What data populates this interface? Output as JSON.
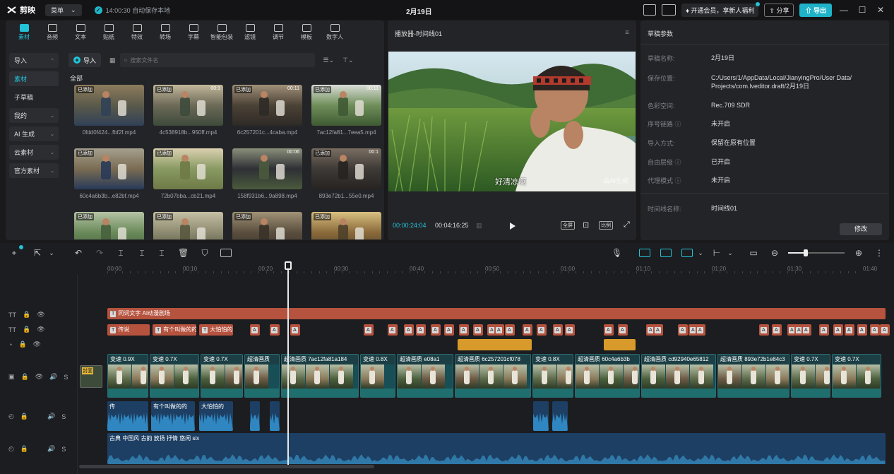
{
  "app": {
    "name": "剪映",
    "menu_label": "菜单",
    "save_status": "14:00:30 自动保存本地",
    "project_title": "2月19日"
  },
  "titlebar": {
    "vip_label": "开通会员，享新人福利",
    "share_label": "分享",
    "export_label": "导出",
    "min": "—",
    "max": "☐",
    "close": "✕"
  },
  "tools": [
    {
      "label": "素材",
      "icon": "media-icon",
      "active": true
    },
    {
      "label": "音频",
      "icon": "audio-icon"
    },
    {
      "label": "文本",
      "icon": "text-icon"
    },
    {
      "label": "贴纸",
      "icon": "sticker-icon"
    },
    {
      "label": "特效",
      "icon": "effects-icon"
    },
    {
      "label": "转场",
      "icon": "transition-icon"
    },
    {
      "label": "字幕",
      "icon": "caption-icon"
    },
    {
      "label": "智能包装",
      "icon": "smart-pack-icon"
    },
    {
      "label": "滤镜",
      "icon": "filter-icon"
    },
    {
      "label": "调节",
      "icon": "adjust-icon"
    },
    {
      "label": "模板",
      "icon": "template-icon"
    },
    {
      "label": "数字人",
      "icon": "avatar-icon"
    }
  ],
  "categories": [
    {
      "label": "导入",
      "style": "box",
      "chev": "⌃"
    },
    {
      "label": "素材",
      "style": "sel",
      "chev": ""
    },
    {
      "label": "子草稿",
      "style": "plain",
      "chev": ""
    },
    {
      "label": "我的",
      "style": "box",
      "chev": "⌄"
    },
    {
      "label": "AI 生成",
      "style": "box",
      "chev": "⌄"
    },
    {
      "label": "云素材",
      "style": "box",
      "chev": "⌄"
    },
    {
      "label": "官方素材",
      "style": "box",
      "chev": "⌄"
    }
  ],
  "media": {
    "import_label": "导入",
    "search_placeholder": "搜索文件名",
    "all_label": "全部",
    "items": [
      {
        "badge": "已添加",
        "dur": "",
        "name": "0fdd0f424...fbf2f.mp4",
        "colors": [
          "#5b5a4a",
          "#8d7c5d",
          "#304157"
        ]
      },
      {
        "badge": "已添加",
        "dur": "00:1",
        "name": "4c538918b...950ff.mp4",
        "colors": [
          "#6d6a58",
          "#c2b79a",
          "#3d4a3b"
        ]
      },
      {
        "badge": "已添加",
        "dur": "00:11",
        "name": "6c257201c...4caba.mp4",
        "colors": [
          "#4c4236",
          "#a09078",
          "#2e2a26"
        ]
      },
      {
        "badge": "已添加",
        "dur": "00:11",
        "name": "7ac12fa81...7eea5.mp4",
        "colors": [
          "#6f8f5a",
          "#d9dcd6",
          "#3f5a33"
        ]
      },
      {
        "badge": "已添加",
        "dur": "",
        "name": "60c4a6b3b...e82bf.mp4",
        "colors": [
          "#7a6c52",
          "#a5a08e",
          "#283a59"
        ]
      },
      {
        "badge": "已添加",
        "dur": "",
        "name": "72b07bba...cb21.mp4",
        "colors": [
          "#889a62",
          "#dbd0b0",
          "#6e7a46"
        ]
      },
      {
        "badge": "",
        "dur": "00:06",
        "name": "158f931b6...9a898.mp4",
        "colors": [
          "#2e3035",
          "#8a8f7a",
          "#4a5a3c"
        ]
      },
      {
        "badge": "已添加",
        "dur": "00:1",
        "name": "893e72b1...55e0.mp4",
        "colors": [
          "#3e3a36",
          "#7a6e62",
          "#262321"
        ]
      },
      {
        "badge": "已添加",
        "dur": "",
        "name": "",
        "colors": [
          "#6a8a5a",
          "#b4c3a4",
          "#46603c"
        ]
      },
      {
        "badge": "已添加",
        "dur": "",
        "name": "",
        "colors": [
          "#8c8a70",
          "#c6c0a4",
          "#58583e"
        ]
      },
      {
        "badge": "已添加",
        "dur": "",
        "name": "",
        "colors": [
          "#5a4e3e",
          "#a09276",
          "#3a3228"
        ]
      },
      {
        "badge": "已添加",
        "dur": "",
        "name": "",
        "colors": [
          "#8a6a3a",
          "#d8c080",
          "#4e402a"
        ]
      }
    ]
  },
  "player": {
    "title": "播放器-时间线01",
    "subtitle": "好清凉啊",
    "watermark": "由AI生成",
    "current": "00:00:24:04",
    "duration": "00:04:16:25",
    "btn_full": "全屏",
    "btn_ratio": "比例"
  },
  "props": {
    "title": "草稿参数",
    "rows": [
      {
        "k": "草稿名称:",
        "v": "2月19日"
      },
      {
        "k": "保存位置:",
        "v": "C:/Users/1/AppData/Local/JianyingPro/User Data/ Projects/com.lveditor.draft/2月19日"
      },
      {
        "k": "色彩空间:",
        "v": "Rec.709 SDR"
      },
      {
        "k": "序号链路 ⓘ",
        "v": "未开启"
      },
      {
        "k": "导入方式:",
        "v": "保留在原有位置"
      },
      {
        "k": "自由层级 ⓘ",
        "v": "已开启"
      },
      {
        "k": "代理模式 ⓘ",
        "v": "未开启"
      }
    ],
    "timeline_name_k": "时间线名称:",
    "timeline_name_v": "时间线01",
    "modify_label": "修改"
  },
  "ruler": [
    "00:00",
    "00:10",
    "00:20",
    "00:30",
    "00:40",
    "00:50",
    "01:00",
    "01:10",
    "01:20",
    "01:30",
    "01:40"
  ],
  "tracks": {
    "ai_text": "同词文字 AI动漫剧场",
    "text_clips": [
      {
        "w": 60,
        "label": "传说"
      },
      {
        "w": 62,
        "label": "有个叫做的的"
      },
      {
        "w": 48,
        "label": "大怕怕的"
      }
    ],
    "video_clips": [
      {
        "w": 58,
        "label": "变速 0.9X"
      },
      {
        "w": 70,
        "label": "变速 0.7X"
      },
      {
        "w": 60,
        "label": "变速 0.7X"
      },
      {
        "w": 50,
        "label": "超清画质"
      },
      {
        "w": 110,
        "label": "超清画质  7ac12fa81a184"
      },
      {
        "w": 50,
        "label": "变速 0.8X"
      },
      {
        "w": 80,
        "label": "超清画质  e08a1"
      },
      {
        "w": 108,
        "label": "超清画质  6c257201cf078"
      },
      {
        "w": 58,
        "label": "变速 0.8X"
      },
      {
        "w": 92,
        "label": "超清画质  60c4a6b3b"
      },
      {
        "w": 106,
        "label": "超清画质  cd92940e65812"
      },
      {
        "w": 102,
        "label": "超清画质  893e72b1e84c3"
      },
      {
        "w": 56,
        "label": "变速 0.7X"
      },
      {
        "w": 70,
        "label": "变速 0.7X"
      }
    ],
    "audio_clips": [
      {
        "w": 58,
        "label": "传"
      },
      {
        "w": 62,
        "label": "有个叫做的的"
      },
      {
        "w": 48,
        "label": "大怕怕的"
      }
    ],
    "music_label": "古典 中国风 古韵 放扬 抒情 悠闲  six",
    "cover_label": "封面"
  }
}
